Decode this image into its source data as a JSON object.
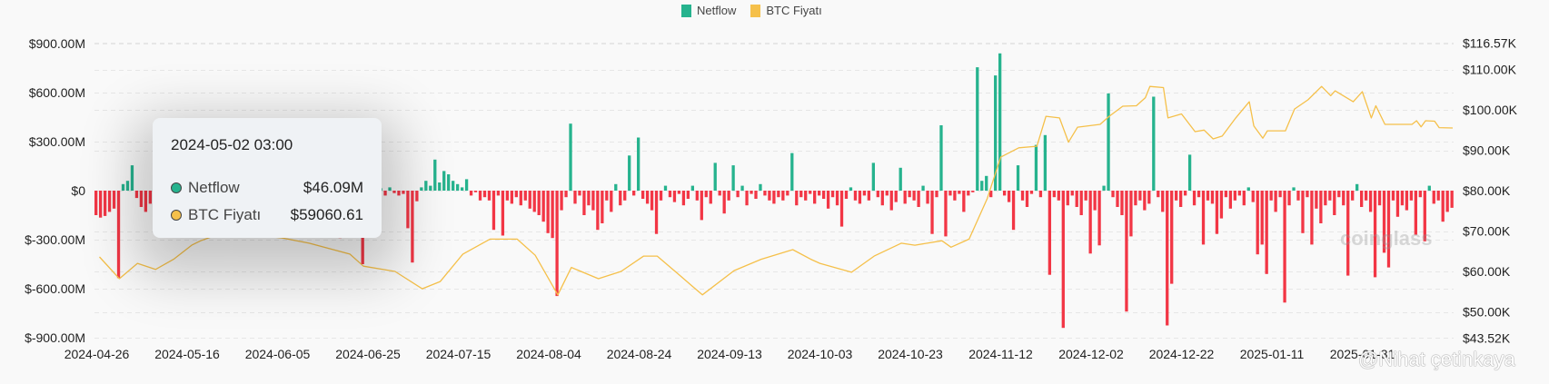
{
  "chart_data": {
    "type": "bar+line",
    "legend": {
      "position": "top-center",
      "items": [
        {
          "name": "Netflow",
          "color": "#26b38e"
        },
        {
          "name": "BTC Fiyatı",
          "color": "#f5c04a"
        }
      ]
    },
    "colors": {
      "positive": "#26b38e",
      "negative": "#f23645",
      "price": "#f5c04a"
    },
    "start_date": "2024-04-26",
    "x_tick_labels": [
      "2024-04-26",
      "2024-05-16",
      "2024-06-05",
      "2024-06-25",
      "2024-07-15",
      "2024-08-04",
      "2024-08-24",
      "2024-09-13",
      "2024-10-03",
      "2024-10-23",
      "2024-11-12",
      "2024-12-02",
      "2024-12-22",
      "2025-01-11",
      "2025-01-31"
    ],
    "x_tick_interval_days": 20,
    "y_left": {
      "unit": "USD millions",
      "range": [
        -900,
        900
      ],
      "ticks": [
        900,
        600,
        300,
        0,
        -300,
        -600,
        -900
      ],
      "tick_labels": [
        "$900.00M",
        "$600.00M",
        "$300.00M",
        "$0",
        "$-300.00M",
        "$-600.00M",
        "$-900.00M"
      ]
    },
    "y_right": {
      "unit": "USD thousands",
      "range": [
        43.52,
        116.57
      ],
      "ticks": [
        116.57,
        110,
        100,
        90,
        80,
        70,
        60,
        50,
        43.52
      ],
      "tick_labels": [
        "$116.57K",
        "$110.00K",
        "$100.00K",
        "$90.00K",
        "$80.00K",
        "$70.00K",
        "$60.00K",
        "$50.00K",
        "$43.52K"
      ]
    },
    "netflow_daily_millions": [
      -150,
      -165,
      -155,
      -130,
      -110,
      -535,
      40,
      60,
      155,
      -45,
      -100,
      -130,
      -80,
      -60,
      -30,
      20,
      -40,
      30,
      -20,
      -50,
      -60,
      30,
      -80,
      40,
      -50,
      -90,
      20,
      -40,
      -70,
      30,
      -50,
      -120,
      60,
      -90,
      -40,
      25,
      -70,
      -30,
      45,
      -60,
      -80,
      35,
      -40,
      -110,
      50,
      -30,
      -60,
      -20,
      40,
      -90,
      -70,
      30,
      -40,
      -50,
      -290,
      -60,
      20,
      -30,
      40,
      -450,
      30,
      -20,
      -25,
      15,
      -30,
      20,
      -15,
      -30,
      -20,
      -230,
      -440,
      -65,
      20,
      60,
      30,
      190,
      50,
      120,
      100,
      60,
      40,
      20,
      70,
      -30,
      -10,
      -60,
      -40,
      -60,
      -240,
      -30,
      -275,
      -60,
      -80,
      -40,
      -90,
      -60,
      -110,
      -130,
      -150,
      -190,
      -260,
      -290,
      -645,
      -120,
      -40,
      410,
      -80,
      -30,
      -150,
      -90,
      -120,
      -240,
      -200,
      -60,
      -130,
      40,
      -90,
      -60,
      215,
      -30,
      325,
      -50,
      -80,
      -120,
      -265,
      -60,
      30,
      -40,
      -70,
      -20,
      -90,
      -50,
      30,
      -60,
      -180,
      -40,
      -80,
      170,
      -30,
      -140,
      -60,
      155,
      -40,
      30,
      -90,
      -20,
      -50,
      40,
      -30,
      -60,
      -80,
      -40,
      -60,
      -30,
      230,
      -90,
      -40,
      -60,
      -20,
      -80,
      -30,
      -50,
      -110,
      -40,
      -90,
      -220,
      -50,
      20,
      -60,
      -80,
      -30,
      -60,
      170,
      -40,
      -90,
      -30,
      -120,
      -70,
      140,
      -80,
      -40,
      -60,
      -100,
      30,
      -80,
      -265,
      -40,
      400,
      -280,
      -30,
      -60,
      -20,
      -130,
      -30,
      -10,
      755,
      60,
      90,
      -40,
      705,
      840,
      -30,
      -70,
      -240,
      155,
      -60,
      -100,
      -20,
      280,
      -40,
      340,
      -515,
      -40,
      -60,
      -840,
      -90,
      -30,
      -100,
      -150,
      -60,
      -385,
      -120,
      -335,
      30,
      595,
      -40,
      -100,
      -150,
      -740,
      -280,
      -90,
      -60,
      -120,
      -80,
      575,
      -40,
      -130,
      -825,
      -570,
      -60,
      -100,
      -30,
      220,
      -90,
      -40,
      -330,
      -60,
      -80,
      -265,
      -170,
      -40,
      -110,
      -60,
      -30,
      -90,
      20,
      -70,
      -390,
      -330,
      -510,
      -60,
      -130,
      -40,
      -685,
      -90,
      20,
      -60,
      -260,
      -40,
      -330,
      -110,
      -200,
      -90,
      -60,
      -150,
      -40,
      -90,
      -520,
      -60,
      40,
      -100,
      -60,
      -130,
      -530,
      -90,
      -380,
      -470,
      -60,
      -160,
      -90,
      -120,
      -60,
      -270,
      -40,
      -310,
      30,
      -80,
      -60,
      -190,
      -130,
      -105
    ],
    "btc_price_k": [
      [
        0.6,
        63.6
      ],
      [
        5,
        58.2
      ],
      [
        9,
        62
      ],
      [
        13,
        60.5
      ],
      [
        17,
        63
      ],
      [
        21,
        66.5
      ],
      [
        23,
        67.6
      ],
      [
        29,
        70
      ],
      [
        35,
        69
      ],
      [
        41,
        68.3
      ],
      [
        47,
        67
      ],
      [
        56,
        64.3
      ],
      [
        59,
        61.3
      ],
      [
        66,
        60
      ],
      [
        72,
        55.7
      ],
      [
        76,
        57.5
      ],
      [
        81,
        64.3
      ],
      [
        87,
        68
      ],
      [
        93,
        68
      ],
      [
        97,
        64
      ],
      [
        102,
        54.2
      ],
      [
        105,
        61
      ],
      [
        111,
        58.2
      ],
      [
        116,
        60
      ],
      [
        121,
        63.8
      ],
      [
        124,
        63.8
      ],
      [
        129,
        59
      ],
      [
        134,
        54.2
      ],
      [
        141,
        60.2
      ],
      [
        147,
        63
      ],
      [
        154,
        65.4
      ],
      [
        158,
        63
      ],
      [
        160,
        62
      ],
      [
        167,
        59.8
      ],
      [
        172,
        63.8
      ],
      [
        178,
        67
      ],
      [
        181,
        66.5
      ],
      [
        187,
        67.6
      ],
      [
        189,
        66
      ],
      [
        193,
        68
      ],
      [
        197,
        78
      ],
      [
        200,
        88.3
      ],
      [
        204,
        90.6
      ],
      [
        208,
        91
      ],
      [
        210,
        98.4
      ],
      [
        213,
        98
      ],
      [
        215,
        92
      ],
      [
        217,
        95.7
      ],
      [
        222,
        96.4
      ],
      [
        224,
        98.4
      ],
      [
        227,
        100.9
      ],
      [
        230,
        101
      ],
      [
        232,
        103
      ],
      [
        233,
        105.8
      ],
      [
        236,
        105.5
      ],
      [
        237,
        98
      ],
      [
        240,
        99
      ],
      [
        243,
        94.6
      ],
      [
        245,
        95
      ],
      [
        247,
        92.8
      ],
      [
        249,
        93.5
      ],
      [
        252,
        98
      ],
      [
        255,
        102
      ],
      [
        256,
        96
      ],
      [
        258,
        93
      ],
      [
        259,
        94.8
      ],
      [
        263,
        94.8
      ],
      [
        265,
        100.2
      ],
      [
        268,
        102.5
      ],
      [
        271,
        105.8
      ],
      [
        273,
        103.5
      ],
      [
        274,
        104.7
      ],
      [
        278,
        102
      ],
      [
        280,
        104.5
      ],
      [
        282,
        98
      ],
      [
        283,
        101
      ],
      [
        285,
        96.4
      ],
      [
        291,
        96.4
      ],
      [
        292,
        97.3
      ],
      [
        293,
        95.8
      ],
      [
        294,
        97.3
      ],
      [
        296,
        97.2
      ],
      [
        297,
        95.6
      ],
      [
        300,
        95.5
      ]
    ]
  },
  "tooltip": {
    "title": "2024-05-02 03:00",
    "rows": [
      {
        "label": "Netflow",
        "value": "$46.09M",
        "color": "#26b38e"
      },
      {
        "label": "BTC Fiyatı",
        "value": "$59060.61",
        "color": "#f5c04a"
      }
    ]
  },
  "watermarks": {
    "brand": "coinglass",
    "user": "@Nihat çetinkaya"
  }
}
